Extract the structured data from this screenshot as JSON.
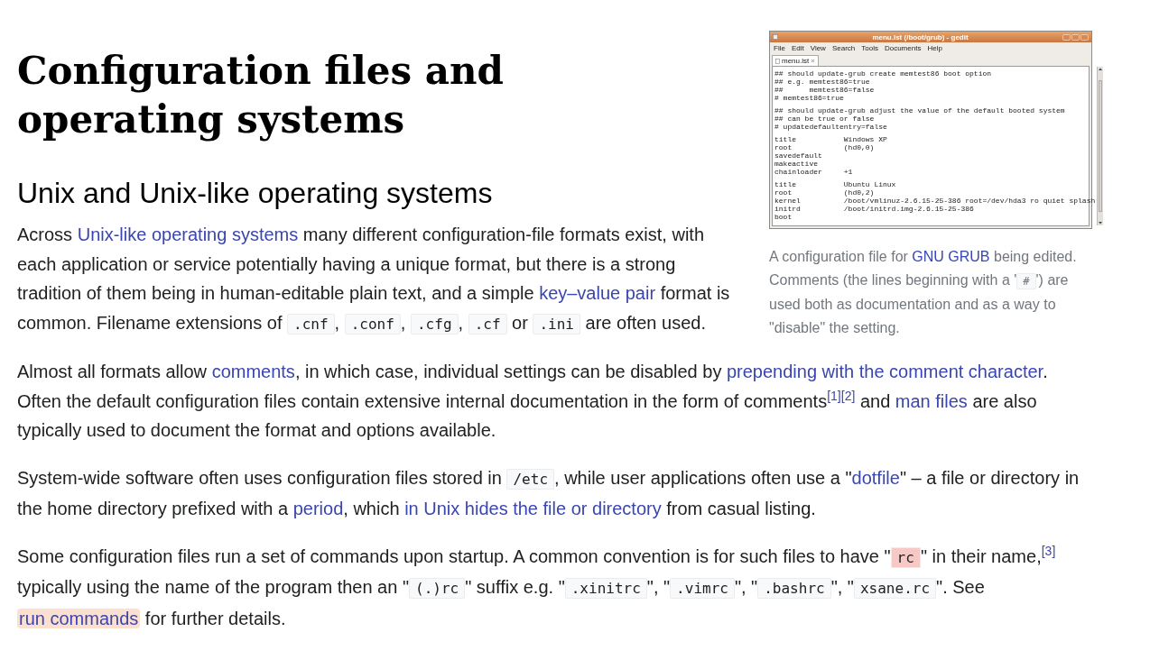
{
  "title": "Configuration files and operating systems",
  "figure": {
    "window": {
      "title": "menu.lst (/boot/grub) - gedit",
      "menus": [
        "File",
        "Edit",
        "View",
        "Search",
        "Tools",
        "Documents",
        "Help"
      ],
      "tab": "menu.lst",
      "blocks": [
        [
          "## should update-grub create memtest86 boot option",
          "## e.g. memtest86=true",
          "##      memtest86=false",
          "# memtest86=true"
        ],
        [
          "## should update-grub adjust the value of the default booted system",
          "## can be true or false",
          "# updatedefaultentry=false"
        ],
        [
          "title           Windows XP",
          "root            (hd0,0)",
          "savedefault",
          "makeactive",
          "chainloader     +1"
        ],
        [
          "title           Ubuntu Linux",
          "root            (hd0,2)",
          "kernel          /boot/vmlinuz-2.6.15-25-386 root=/dev/hda3 ro quiet splash",
          "initrd          /boot/initrd.img-2.6.15-25-386",
          "boot"
        ]
      ]
    },
    "caption": [
      {
        "kind": "text",
        "text": "A configuration file for "
      },
      {
        "kind": "link",
        "text": "GNU GRUB"
      },
      {
        "kind": "text",
        "text": " being edited. Comments (the lines beginning with a '"
      },
      {
        "kind": "code",
        "text": "#"
      },
      {
        "kind": "text",
        "text": "') are used both as documentation and as a way to \"disable\" the setting."
      }
    ]
  },
  "section": {
    "heading": "Unix and Unix-like operating systems",
    "paragraphs": [
      [
        {
          "kind": "text",
          "text": "Across "
        },
        {
          "kind": "link",
          "text": "Unix-like operating systems"
        },
        {
          "kind": "text",
          "text": " many different configuration-file formats exist, with each application or service potentially having a unique format, but there is a strong tradition of them being in human-editable plain text, and a simple "
        },
        {
          "kind": "link",
          "text": "key–value pair"
        },
        {
          "kind": "text",
          "text": " format is common. Filename extensions of "
        },
        {
          "kind": "code",
          "text": ".cnf"
        },
        {
          "kind": "text",
          "text": ", "
        },
        {
          "kind": "code",
          "text": ".conf"
        },
        {
          "kind": "text",
          "text": ", "
        },
        {
          "kind": "code",
          "text": ".cfg"
        },
        {
          "kind": "text",
          "text": ", "
        },
        {
          "kind": "code",
          "text": ".cf"
        },
        {
          "kind": "text",
          "text": " or "
        },
        {
          "kind": "code",
          "text": ".ini"
        },
        {
          "kind": "text",
          "text": " are often used."
        }
      ],
      [
        {
          "kind": "text",
          "text": "Almost all formats allow "
        },
        {
          "kind": "link",
          "text": "comments"
        },
        {
          "kind": "text",
          "text": ", in which case, individual settings can be disabled by "
        },
        {
          "kind": "link",
          "text": "prepending with the comment character"
        },
        {
          "kind": "text",
          "text": ". Often the default configuration files contain extensive internal documentation in the form of comments"
        },
        {
          "kind": "ref",
          "text": "[1]"
        },
        {
          "kind": "ref",
          "text": "[2]"
        },
        {
          "kind": "text",
          "text": " and "
        },
        {
          "kind": "link",
          "text": "man files"
        },
        {
          "kind": "text",
          "text": " are also typically used to document the format and options available."
        }
      ],
      [
        {
          "kind": "text",
          "text": "System-wide software often uses configuration files stored in "
        },
        {
          "kind": "code",
          "text": "/etc"
        },
        {
          "kind": "text",
          "text": ", while user applications often use a \""
        },
        {
          "kind": "link",
          "text": "dotfile"
        },
        {
          "kind": "text",
          "text": "\" – a file or directory in the home directory prefixed with a "
        },
        {
          "kind": "link",
          "text": "period"
        },
        {
          "kind": "text",
          "text": ", which "
        },
        {
          "kind": "link",
          "text": "in Unix hides the file or directory"
        },
        {
          "kind": "text",
          "text": " from casual listing."
        }
      ],
      [
        {
          "kind": "text",
          "text": "Some configuration files run a set of commands upon startup. A common convention is for such files to have \""
        },
        {
          "kind": "code",
          "text": "rc",
          "highlighted": true
        },
        {
          "kind": "text",
          "text": "\" in their name,"
        },
        {
          "kind": "ref",
          "text": "[3]"
        },
        {
          "kind": "text",
          "text": " typically using the name of the program then an \""
        },
        {
          "kind": "code",
          "text": "(.)rc"
        },
        {
          "kind": "text",
          "text": "\" suffix e.g. \""
        },
        {
          "kind": "code",
          "text": ".xinitrc"
        },
        {
          "kind": "text",
          "text": "\", \""
        },
        {
          "kind": "code",
          "text": ".vimrc"
        },
        {
          "kind": "text",
          "text": "\", \""
        },
        {
          "kind": "code",
          "text": ".bashrc"
        },
        {
          "kind": "text",
          "text": "\", \""
        },
        {
          "kind": "code",
          "text": "xsane.rc"
        },
        {
          "kind": "text",
          "text": "\". See "
        },
        {
          "kind": "link",
          "text": "run commands",
          "highlighted": true
        },
        {
          "kind": "text",
          "text": " for further details."
        }
      ]
    ]
  }
}
